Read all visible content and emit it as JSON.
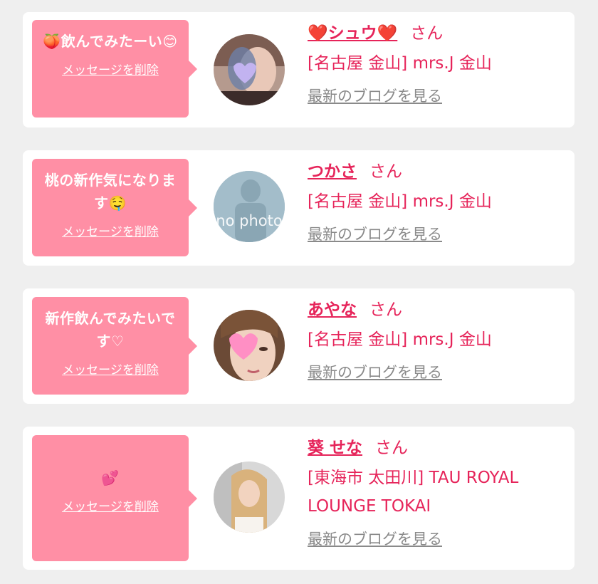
{
  "entries": [
    {
      "message": "🍑飲んでみたーい😊",
      "delete_label": "メッセージを削除",
      "name": "❤️シュウ❤️",
      "honorific": "さん",
      "shop": "[名古屋 金山] mrs.J 金山",
      "blog_link": "最新のブログを見る"
    },
    {
      "message": "桃の新作気になります🤤",
      "delete_label": "メッセージを削除",
      "name": "つかさ",
      "honorific": "さん",
      "shop": "[名古屋 金山] mrs.J 金山",
      "blog_link": "最新のブログを見る",
      "no_photo_label": "no photo"
    },
    {
      "message": "新作飲んでみたいです♡",
      "delete_label": "メッセージを削除",
      "name": "あやな",
      "honorific": "さん",
      "shop": "[名古屋 金山] mrs.J 金山",
      "blog_link": "最新のブログを見る"
    },
    {
      "message": "💕",
      "delete_label": "メッセージを削除",
      "name": "葵 せな",
      "honorific": "さん",
      "shop": "[東海市 太田川] TAU ROYAL LOUNGE TOKAI",
      "blog_link": "最新のブログを見る"
    }
  ],
  "colors": {
    "accent": "#e6245a",
    "bubble": "#ff8fa5",
    "link_gray": "#8a8a8a",
    "background": "#efefef"
  }
}
